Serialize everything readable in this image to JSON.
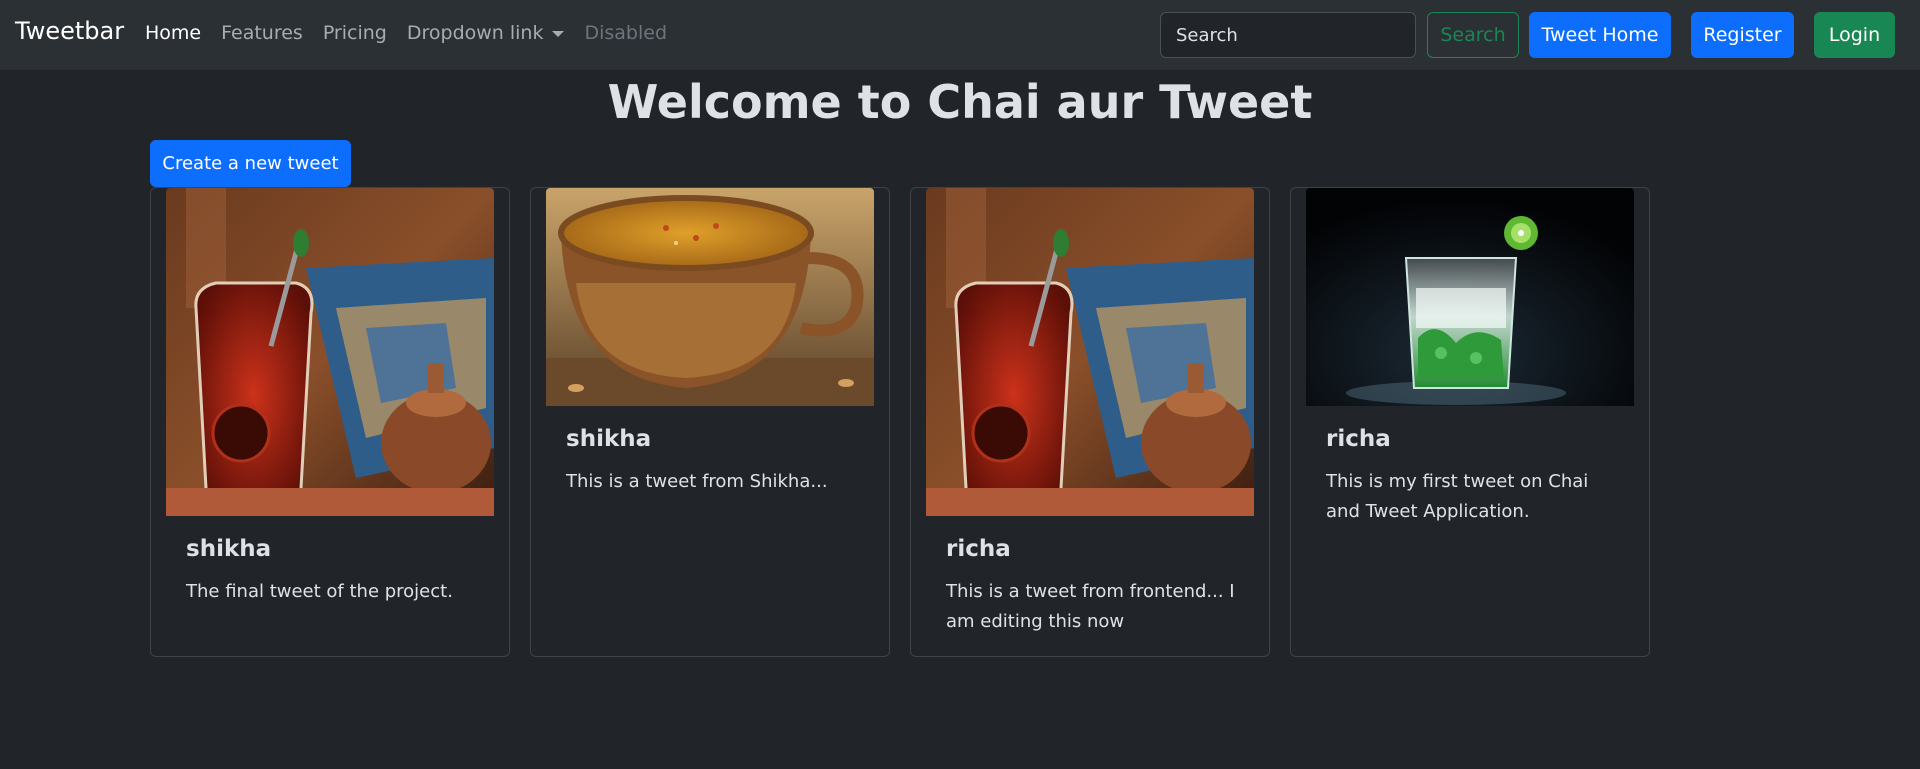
{
  "navbar": {
    "brand": "Tweetbar",
    "links": [
      {
        "label": "Home"
      },
      {
        "label": "Features"
      },
      {
        "label": "Pricing"
      },
      {
        "label": "Dropdown link"
      },
      {
        "label": "Disabled"
      }
    ],
    "search_placeholder": "Search",
    "search_button": "Search",
    "tweet_home_button": "Tweet Home",
    "register_button": "Register",
    "login_button": "Login"
  },
  "page": {
    "title": "Welcome to Chai aur Tweet",
    "create_button": "Create a new tweet"
  },
  "tweets": [
    {
      "author": "shikha",
      "text": "The final tweet of the project.",
      "image": "chai-glass-copper"
    },
    {
      "author": "shikha",
      "text": "This is a tweet from Shikha...",
      "image": "saffron-tea-cup"
    },
    {
      "author": "richa",
      "text": "This is a tweet from frontend... I am editing this now",
      "image": "chai-glass-copper"
    },
    {
      "author": "richa",
      "text": "This is my first tweet on Chai and Tweet Application.",
      "image": "green-mojito-glass"
    }
  ],
  "colors": {
    "background": "#212529",
    "navbar": "#2b3035",
    "primary": "#0d6efd",
    "success": "#198754"
  }
}
